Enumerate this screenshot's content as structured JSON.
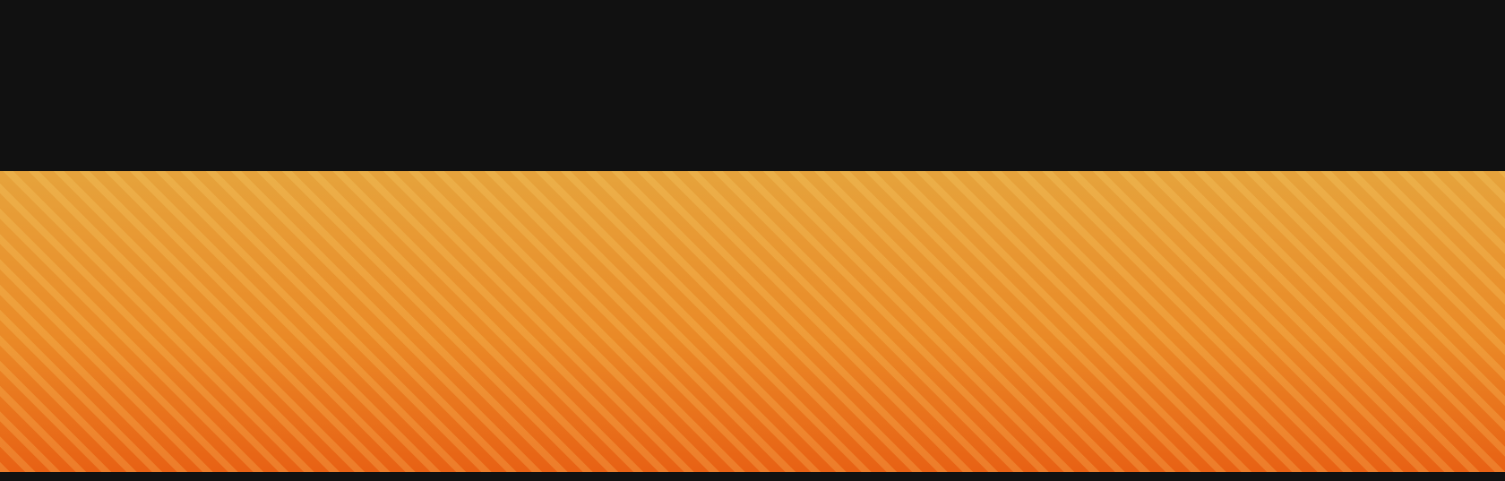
{
  "colors": {
    "background": "#111111",
    "bar_top": "#e6a33c",
    "bar_mid": "#ea8a27",
    "bar_bottom": "#e86114",
    "stripe": "#ffdc78"
  },
  "progress": {
    "value": 1.0
  }
}
